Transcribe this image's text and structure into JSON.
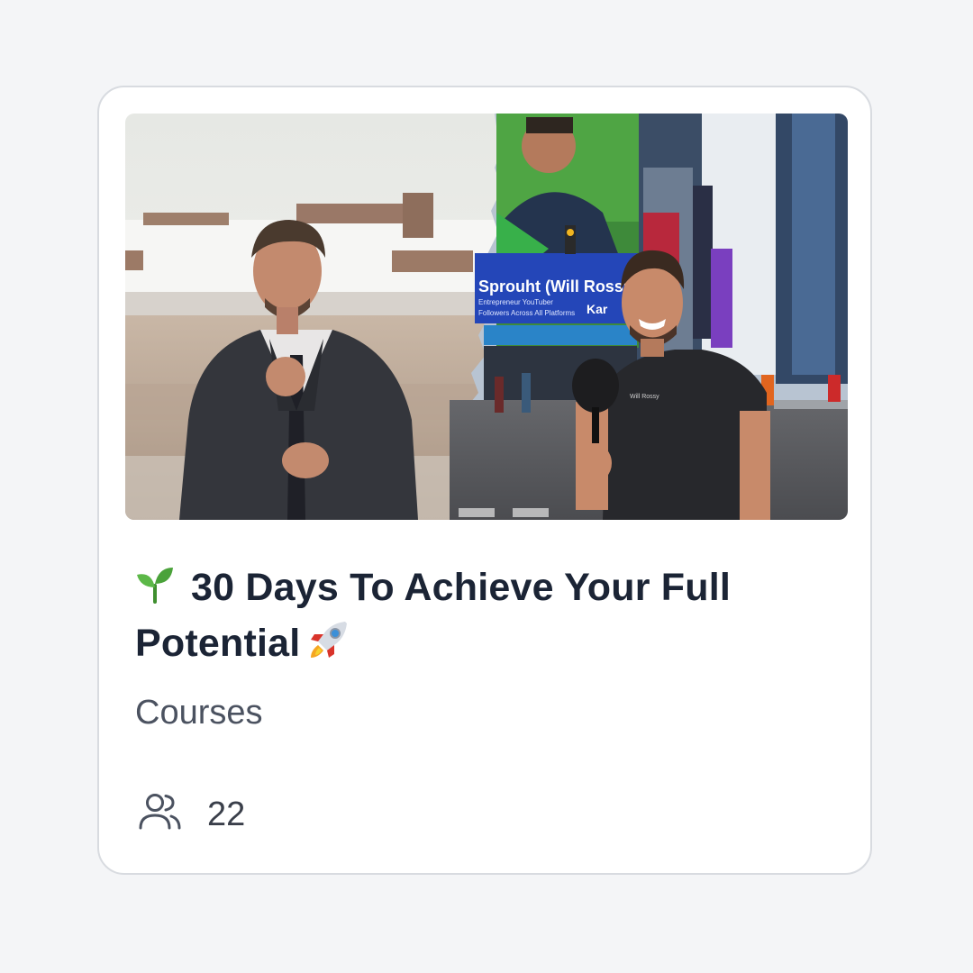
{
  "card": {
    "title": "30 Days To Achieve Your Full Potential",
    "title_leading_emoji": "seedling-icon",
    "title_trailing_emoji": "rocket-icon",
    "category": "Courses",
    "members_icon": "users-icon",
    "members_count": "22",
    "thumbnail": {
      "billboard_name": "Sprouht (Will Rossy)",
      "billboard_subline": "Entrepreneur YouTuber",
      "billboard_subline2": "Followers Across All Platforms",
      "billboard_brand": "Kar"
    }
  },
  "colors": {
    "title": "#1b2435",
    "muted_text": "#4b5260",
    "card_border": "#d8dbe0",
    "page_background": "#f4f5f7"
  }
}
